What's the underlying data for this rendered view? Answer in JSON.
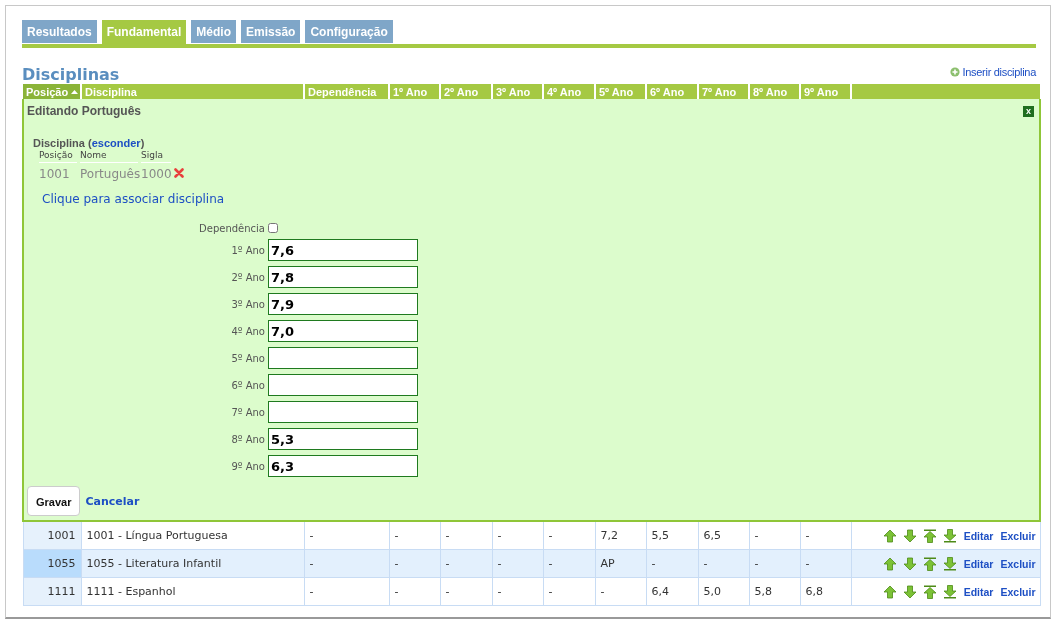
{
  "tabs": [
    {
      "label": "Resultados",
      "selected": false
    },
    {
      "label": "Fundamental",
      "selected": true
    },
    {
      "label": "Médio",
      "selected": false
    },
    {
      "label": "Emissão",
      "selected": false
    },
    {
      "label": "Configuração",
      "selected": false
    }
  ],
  "title": "Disciplinas",
  "insert_link": "Inserir disciplina",
  "table": {
    "columns": [
      {
        "label": "Posição",
        "sorted": true
      },
      {
        "label": "Disciplina",
        "sorted": false
      },
      {
        "label": "Dependência",
        "sorted": false
      },
      {
        "label": "1º Ano",
        "sorted": false
      },
      {
        "label": "2º Ano",
        "sorted": false
      },
      {
        "label": "3º Ano",
        "sorted": false
      },
      {
        "label": "4º Ano",
        "sorted": false
      },
      {
        "label": "5º Ano",
        "sorted": false
      },
      {
        "label": "6º Ano",
        "sorted": false
      },
      {
        "label": "7º Ano",
        "sorted": false
      },
      {
        "label": "8º Ano",
        "sorted": false
      },
      {
        "label": "9º Ano",
        "sorted": false
      }
    ],
    "edit_panel": {
      "title": "Editando Português",
      "close": "x",
      "section_label": "Disciplina",
      "paren_open": "(",
      "hide_link": "esconder",
      "paren_close": ")",
      "sub_columns": [
        "Posição",
        "Nome",
        "Sigla"
      ],
      "sub_values": [
        "1001",
        "Português",
        "1000"
      ],
      "associate_link": "Clique para associar disciplina",
      "dependency_label": "Dependência",
      "dependency_checked": false,
      "grades": [
        {
          "label": "1º Ano",
          "value": "7,6"
        },
        {
          "label": "2º Ano",
          "value": "7,8"
        },
        {
          "label": "3º Ano",
          "value": "7,9"
        },
        {
          "label": "4º Ano",
          "value": "7,0"
        },
        {
          "label": "5º Ano"
        },
        {
          "label": "6º Ano"
        },
        {
          "label": "7º Ano"
        },
        {
          "label": "8º Ano",
          "value": "5,3"
        },
        {
          "label": "9º Ano",
          "value": "6,3"
        }
      ],
      "save": "Gravar",
      "cancel": "Cancelar"
    },
    "rows": [
      {
        "selected": false,
        "cells": [
          "1001",
          "1001 - Língua Portuguesa",
          "-",
          "-",
          "-",
          "-",
          "-",
          "7,2",
          "5,5",
          "6,5",
          "-",
          "-"
        ],
        "edit": "Editar",
        "delete": "Excluir"
      },
      {
        "selected": true,
        "cells": [
          "1055",
          "1055 - Literatura Infantil",
          "-",
          "-",
          "-",
          "-",
          "-",
          "AP",
          "-",
          "-",
          "-",
          "-"
        ],
        "edit": "Editar",
        "delete": "Excluir"
      },
      {
        "selected": false,
        "cells": [
          "1111",
          "1111 - Espanhol",
          "-",
          "-",
          "-",
          "-",
          "-",
          "-",
          "6,4",
          "5,0",
          "5,8",
          "6,8"
        ],
        "edit": "Editar",
        "delete": "Excluir"
      }
    ]
  }
}
